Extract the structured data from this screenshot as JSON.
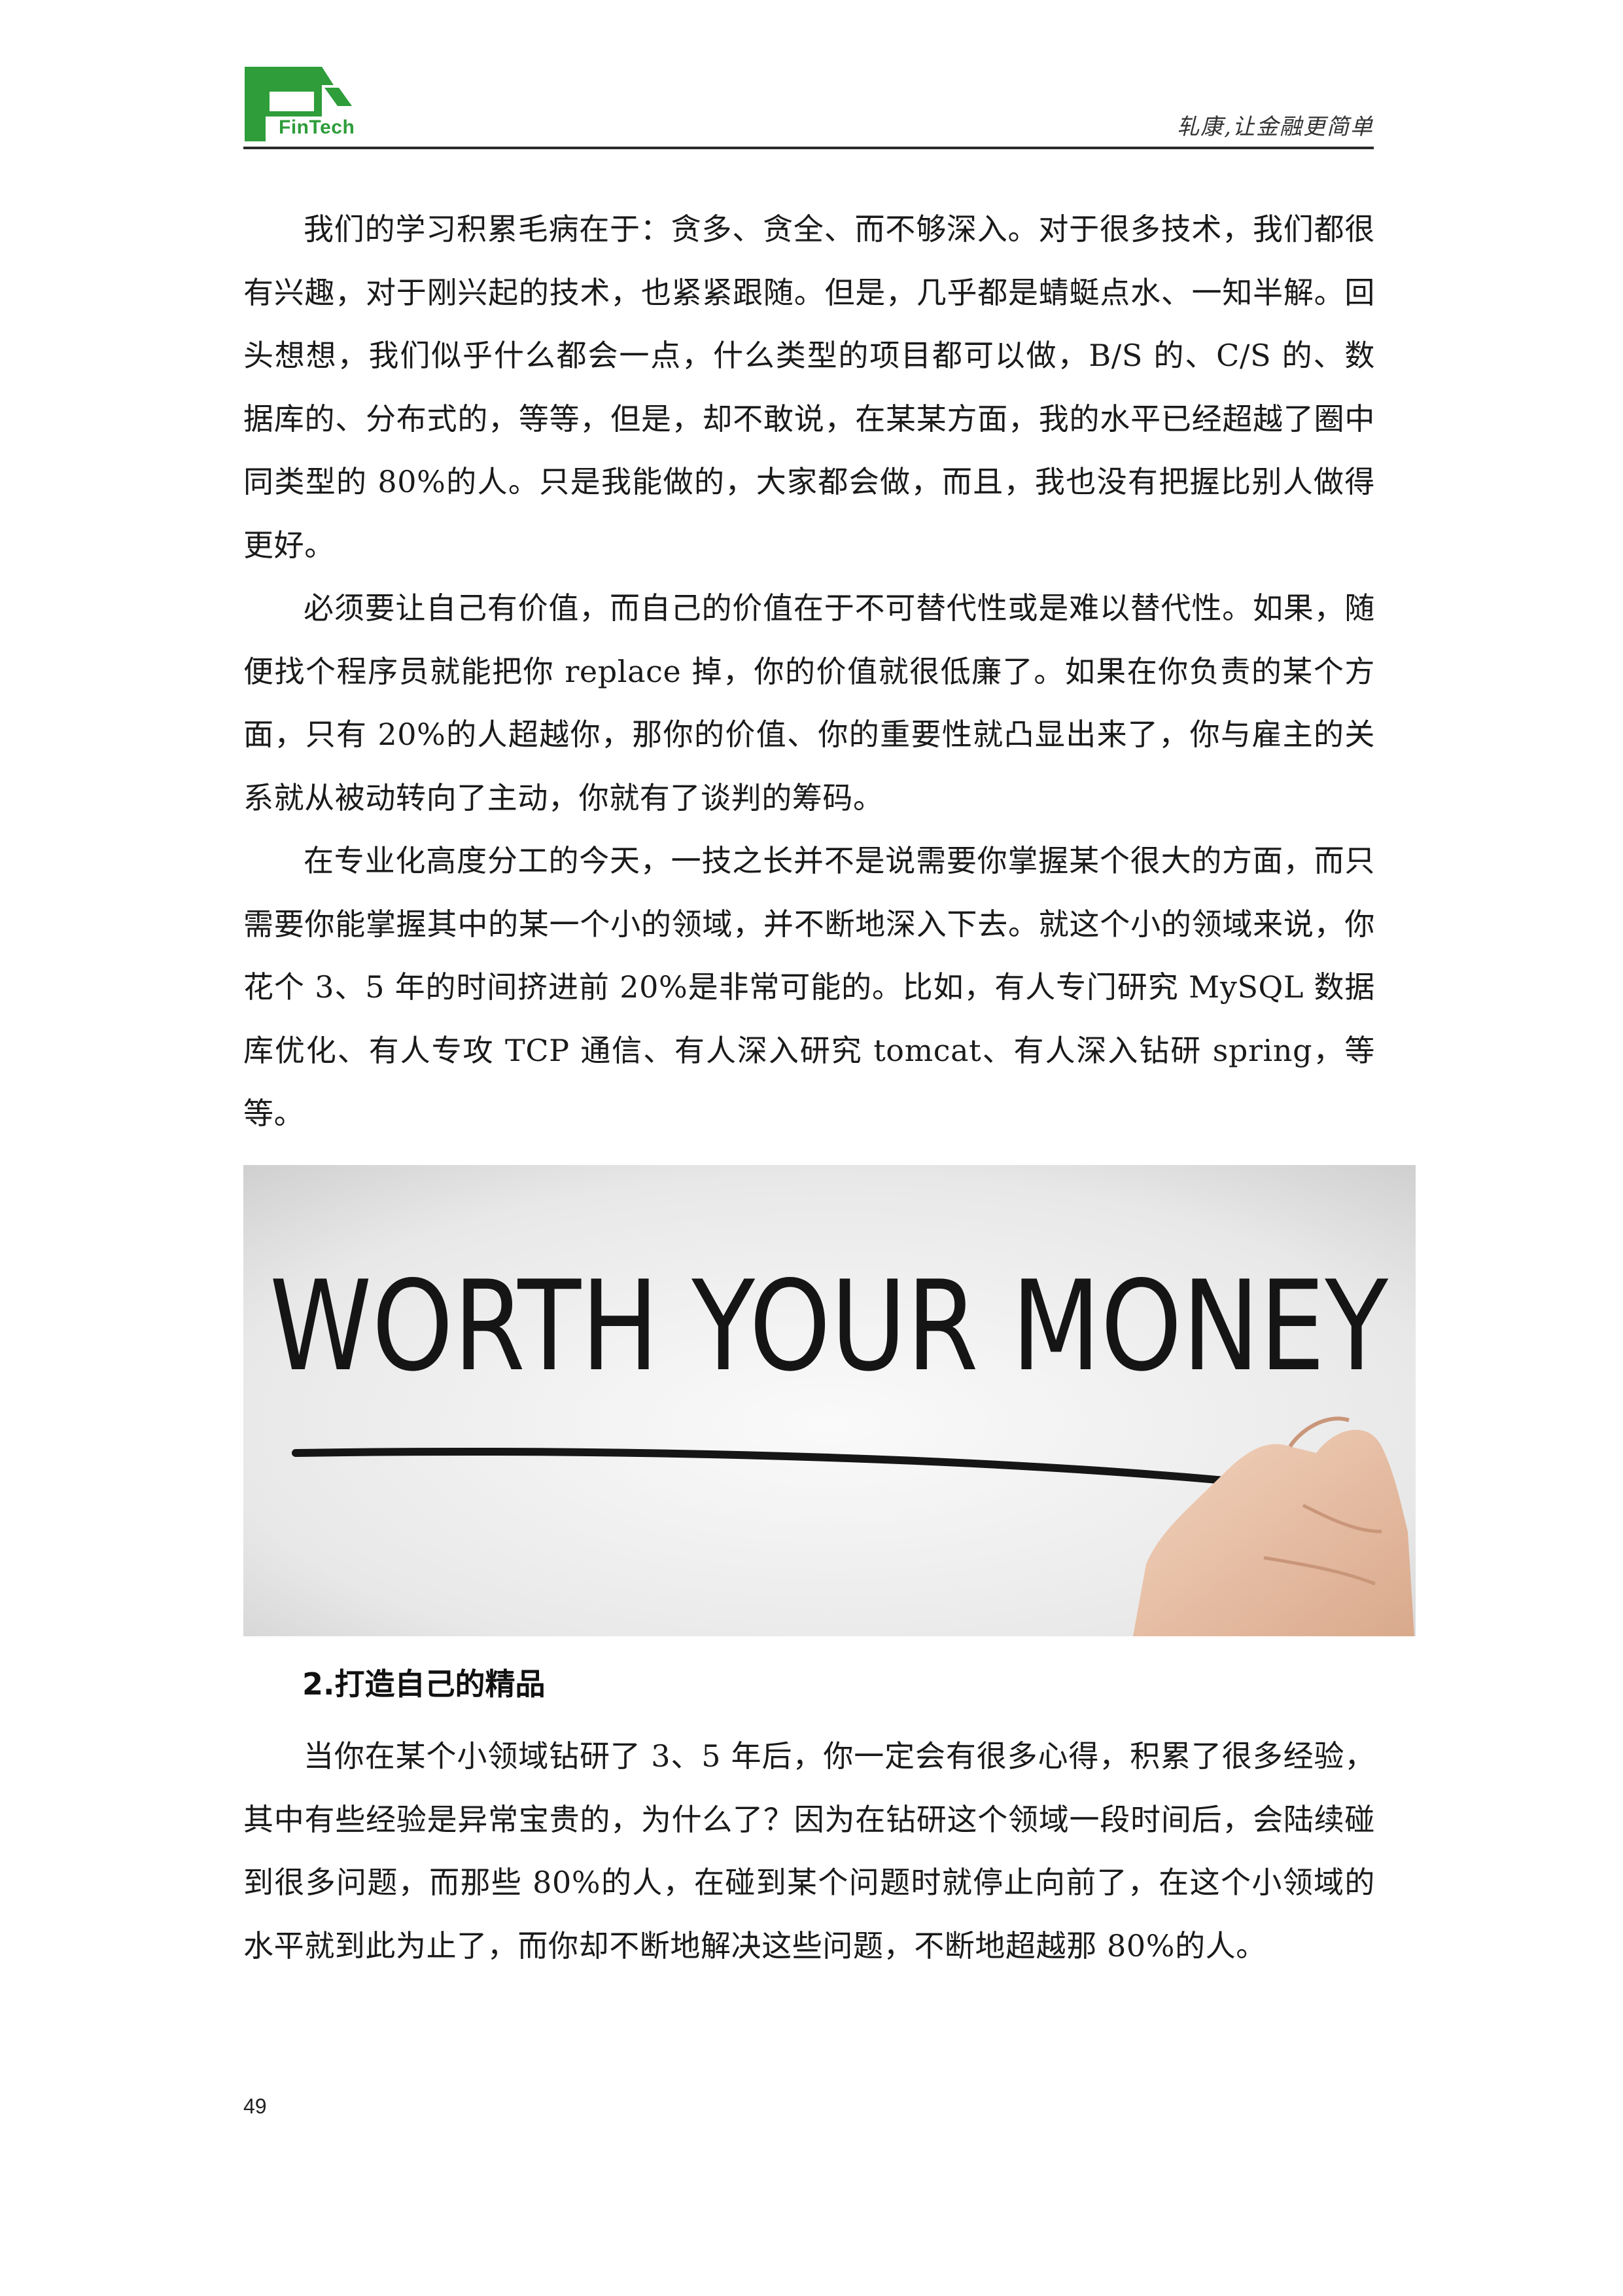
{
  "header": {
    "logo_text": "FinTech",
    "slogan": "轧康,让金融更简单",
    "colors": {
      "logo_green": "#2e9d3a",
      "rule": "#2a2a2a"
    }
  },
  "paragraphs": [
    "我们的学习积累毛病在于：贪多、贪全、而不够深入。对于很多技术，我们都很有兴趣，对于刚兴起的技术，也紧紧跟随。但是，几乎都是蜻蜓点水、一知半解。回头想想，我们似乎什么都会一点，什么类型的项目都可以做，B/S 的、C/S 的、数据库的、分布式的，等等，但是，却不敢说，在某某方面，我的水平已经超越了圈中同类型的 80%的人。只是我能做的，大家都会做，而且，我也没有把握比别人做得更好。",
    "必须要让自己有价值，而自己的价值在于不可替代性或是难以替代性。如果，随便找个程序员就能把你 replace 掉，你的价值就很低廉了。如果在你负责的某个方面，只有 20%的人超越你，那你的价值、你的重要性就凸显出来了，你与雇主的关系就从被动转向了主动，你就有了谈判的筹码。",
    "在专业化高度分工的今天，一技之长并不是说需要你掌握某个很大的方面，而只需要你能掌握其中的某一个小的领域，并不断地深入下去。就这个小的领域来说，你花个 3、5 年的时间挤进前 20%是非常可能的。比如，有人专门研究 MySQL 数据库优化、有人专攻 TCP 通信、有人深入研究 tomcat、有人深入钻研 spring，等等。"
  ],
  "photo": {
    "text": "WORTH YOUR MONEY"
  },
  "section": {
    "heading": "2.打造自己的精品",
    "paragraph": "当你在某个小领域钻研了 3、5 年后，你一定会有很多心得，积累了很多经验，其中有些经验是异常宝贵的，为什么了？因为在钻研这个领域一段时间后，会陆续碰到很多问题，而那些 80%的人，在碰到某个问题时就停止向前了，在这个小领域的水平就到此为止了，而你却不断地解决这些问题，不断地超越那 80%的人。"
  },
  "page_number": "49"
}
